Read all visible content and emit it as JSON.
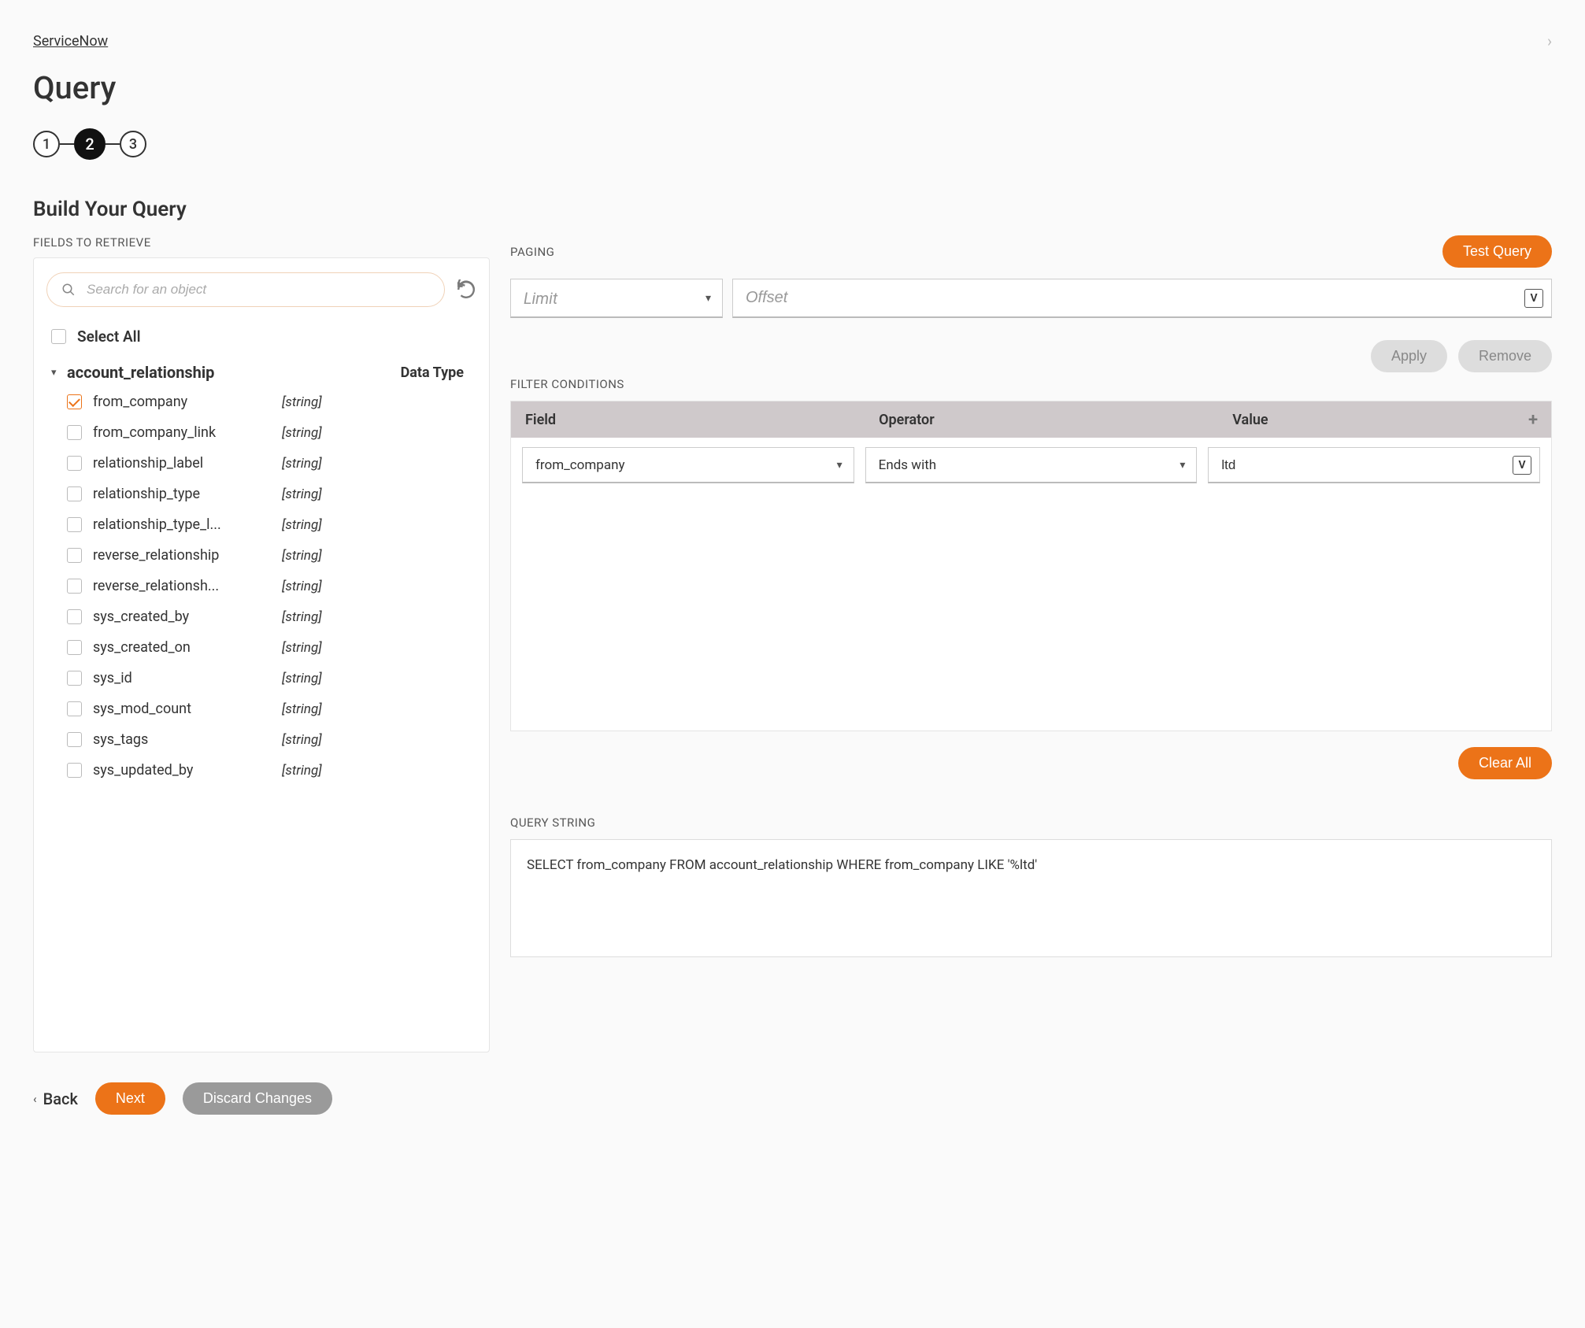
{
  "breadcrumb": {
    "link": "ServiceNow"
  },
  "page_title": "Query",
  "stepper": {
    "steps": [
      "1",
      "2",
      "3"
    ],
    "active_index": 1
  },
  "section_title": "Build Your Query",
  "fields_panel": {
    "heading": "FIELDS TO RETRIEVE",
    "search_placeholder": "Search for an object",
    "select_all_label": "Select All",
    "table_name": "account_relationship",
    "datatype_heading": "Data Type",
    "fields": [
      {
        "name": "from_company",
        "type": "[string]",
        "checked": true
      },
      {
        "name": "from_company_link",
        "type": "[string]",
        "checked": false
      },
      {
        "name": "relationship_label",
        "type": "[string]",
        "checked": false
      },
      {
        "name": "relationship_type",
        "type": "[string]",
        "checked": false
      },
      {
        "name": "relationship_type_l...",
        "type": "[string]",
        "checked": false
      },
      {
        "name": "reverse_relationship",
        "type": "[string]",
        "checked": false
      },
      {
        "name": "reverse_relationsh...",
        "type": "[string]",
        "checked": false
      },
      {
        "name": "sys_created_by",
        "type": "[string]",
        "checked": false
      },
      {
        "name": "sys_created_on",
        "type": "[string]",
        "checked": false
      },
      {
        "name": "sys_id",
        "type": "[string]",
        "checked": false
      },
      {
        "name": "sys_mod_count",
        "type": "[string]",
        "checked": false
      },
      {
        "name": "sys_tags",
        "type": "[string]",
        "checked": false
      },
      {
        "name": "sys_updated_by",
        "type": "[string]",
        "checked": false
      }
    ]
  },
  "paging": {
    "heading": "PAGING",
    "limit_placeholder": "Limit",
    "offset_placeholder": "Offset"
  },
  "buttons": {
    "test_query": "Test Query",
    "apply": "Apply",
    "remove": "Remove",
    "clear_all": "Clear All",
    "back": "Back",
    "next": "Next",
    "discard": "Discard Changes"
  },
  "filter": {
    "heading": "FILTER CONDITIONS",
    "columns": {
      "field": "Field",
      "operator": "Operator",
      "value": "Value"
    },
    "conditions": [
      {
        "field": "from_company",
        "operator": "Ends with",
        "value": "ltd"
      }
    ]
  },
  "query_string": {
    "heading": "QUERY STRING",
    "value": "SELECT from_company FROM account_relationship WHERE from_company LIKE '%ltd'"
  }
}
